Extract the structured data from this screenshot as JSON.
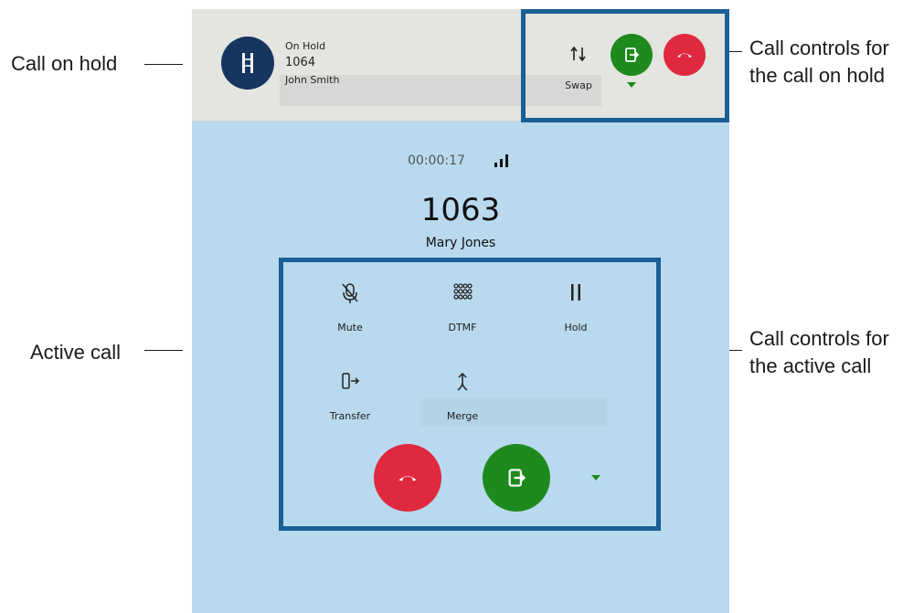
{
  "annotations": {
    "call_on_hold": "Call on hold",
    "active_call": "Active call",
    "hold_controls": [
      "Call controls for",
      "the call on hold"
    ],
    "active_controls": [
      "Call controls for",
      "the active call"
    ]
  },
  "held_call": {
    "status": "On Hold",
    "number": "1064",
    "name": "John Smith",
    "swap_label": "Swap"
  },
  "active_call": {
    "timer": "00:00:17",
    "number": "1063",
    "name": "Mary Jones",
    "controls": [
      {
        "label": "Mute",
        "icon": "mic-off-icon"
      },
      {
        "label": "DTMF",
        "icon": "keypad-icon"
      },
      {
        "label": "Hold",
        "icon": "pause-icon"
      },
      {
        "label": "Transfer",
        "icon": "transfer-icon"
      },
      {
        "label": "Merge",
        "icon": "merge-icon"
      }
    ]
  },
  "colors": {
    "accept_green": "#1e8a1e",
    "hangup_red": "#e0293f",
    "annotation_box": "#1a5f96",
    "panel_blue": "#b9d9ee"
  }
}
